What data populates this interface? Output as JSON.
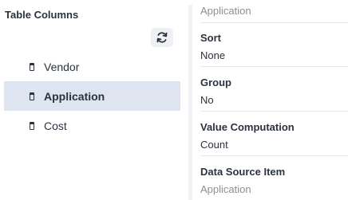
{
  "left_panel": {
    "title": "Table Columns",
    "refresh_icon": "refresh-icon",
    "columns": [
      {
        "label": "Vendor",
        "selected": false
      },
      {
        "label": "Application",
        "selected": true
      },
      {
        "label": "Cost",
        "selected": false
      }
    ]
  },
  "right_panel": {
    "header_value": "Application",
    "sort": {
      "label": "Sort",
      "value": "None"
    },
    "group": {
      "label": "Group",
      "value": "No"
    },
    "value_computation": {
      "label": "Value Computation",
      "value": "Count"
    },
    "data_source_item": {
      "label": "Data Source Item",
      "value": "Application"
    }
  }
}
